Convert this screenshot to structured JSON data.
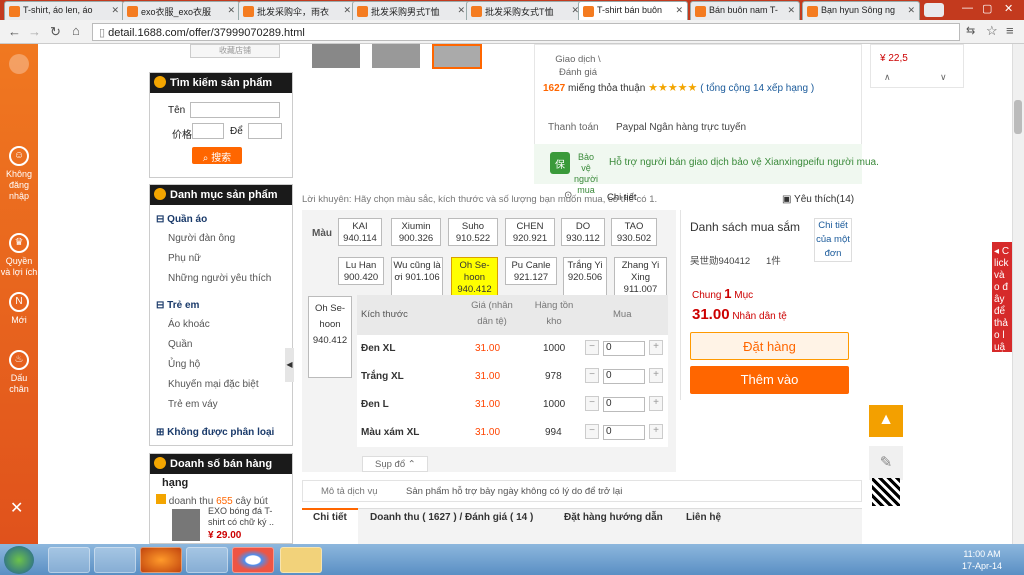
{
  "tabs": [
    {
      "label": "T-shirt, áo len, áo"
    },
    {
      "label": "exo衣服_exo衣服"
    },
    {
      "label": "批发采购伞，雨衣"
    },
    {
      "label": "批发采购男式T恤"
    },
    {
      "label": "批发采购女式T恤"
    },
    {
      "label": "T-shirt bán buôn"
    },
    {
      "label": "Bán buôn nam T-"
    },
    {
      "label": "Bạn hyun Sông ng"
    }
  ],
  "url": "detail.1688.com/offer/37999070289.html",
  "leftbar": [
    {
      "label": "Không\nđăng\nnhập",
      "icon": "user-icon"
    },
    {
      "label": "Quyền\nvà lợi ích",
      "icon": "crown-icon"
    },
    {
      "label": "Mới",
      "icon": "new-icon"
    },
    {
      "label": "Dấu\nchân",
      "icon": "footprint-icon"
    }
  ],
  "top_button": "收藏店铺",
  "search_panel": {
    "title": "Tìm kiếm sản phẩm",
    "name_label": "Tên",
    "price_label": "价格",
    "to_label": "Để",
    "button": "搜索"
  },
  "category_panel": {
    "title": "Danh mục sản phẩm",
    "groups": [
      {
        "title": "Quần áo",
        "items": [
          "Người đàn ông",
          "Phụ nữ",
          "Những người yêu thích"
        ]
      },
      {
        "title": "Trẻ em",
        "items": [
          "Áo khoác",
          "Quần",
          "Ủng hộ",
          "Khuyến mại đặc biệt",
          "Trẻ em váy"
        ]
      }
    ],
    "unclassified": "Không được phân loại"
  },
  "sales_panel": {
    "title": "Doanh số bán hàng",
    "subtitle": "hạng",
    "line1_prefix": "doanh thu",
    "line1_count": "655",
    "line1_suffix": "cây bút",
    "product": "EXO bóng đá T-shirt có chữ ký ..",
    "price": "¥ 29.00"
  },
  "info": {
    "trade_label": "Giao dịch \\ Đánh giá",
    "trade_count": "1627",
    "trade_text": "miếng thỏa thuận",
    "stars": "★★★★★",
    "review_text": "( tổng cộng 14 xếp hạng )",
    "payment_label": "Thanh toán",
    "payment_methods": "Paypal  Ngân hàng trực tuyến",
    "protect_badge": "Bảo vệ người mua",
    "protect_text": "Hỗ trợ người bán giao dịch bảo vệ Xianxingpeifu người mua.",
    "detail_link": "Chi tiết"
  },
  "advice": "Lời khuyên: Hãy chọn màu sắc, kích thước và số lượng bạn muốn mua, có thể có 1.",
  "favorite": "Yêu thích(14)",
  "color_label": "Màu",
  "swatches": [
    {
      "label": "KAI 940.114"
    },
    {
      "label": "Xiumin 900.326"
    },
    {
      "label": "Suho 910.522"
    },
    {
      "label": "CHEN 920.921"
    },
    {
      "label": "DO 930.112"
    },
    {
      "label": "TAO 930.502"
    },
    {
      "label": "Lu Han 900.420"
    },
    {
      "label": "Wu cũng là ơi 901.106"
    },
    {
      "label": "Oh Se-hoon 940.412"
    },
    {
      "label": "Pu Canle 921.127"
    },
    {
      "label": "Trắng Yi 920.506"
    },
    {
      "label": "Zhang Yi Xing 911.007"
    }
  ],
  "side_swatch": "Oh Se-hoon 940.412",
  "table": {
    "headers": [
      "Kích thước",
      "Giá (nhân dân tệ)",
      "Hàng tồn kho",
      "Mua"
    ],
    "rows": [
      {
        "size": "Đen XL",
        "price": "31.00",
        "stock": "1000",
        "qty": "0"
      },
      {
        "size": "Trắng XL",
        "price": "31.00",
        "stock": "978",
        "qty": "0"
      },
      {
        "size": "Đen L",
        "price": "31.00",
        "stock": "1000",
        "qty": "0"
      },
      {
        "size": "Màu xám XL",
        "price": "31.00",
        "stock": "994",
        "qty": "0"
      }
    ],
    "collapse": "Sụp đổ"
  },
  "cart": {
    "title": "Danh sách mua sắm",
    "detail": "Chi tiết của một đơn",
    "user": "吴世勋940412",
    "qty": "1件",
    "total_label": "Chung",
    "total_qty": "1",
    "total_unit": "Mục",
    "total_price": "31.00",
    "currency": "Nhân dân tệ",
    "order_btn": "Đặt hàng",
    "add_btn": "Thêm vào"
  },
  "service": {
    "label": "Mô tả dịch vụ",
    "text": "Sản phẩm hỗ trợ bảy ngày không có lý do để trở lại"
  },
  "footer_tabs": [
    {
      "label": "Chi tiết"
    },
    {
      "label": "Doanh thu ( 1627 ) / Đánh giá ( 14 )"
    },
    {
      "label": "Đặt hàng hướng dẫn"
    },
    {
      "label": "Liên hệ"
    }
  ],
  "right_price": "¥ 22,5",
  "red_side": "Click vào đây để thảo luận",
  "clock": {
    "time": "11:00 AM",
    "date": "17-Apr-14"
  },
  "colors": {
    "orange": "#ff6600",
    "price_red": "#ff4400",
    "accent": "#f3a500"
  }
}
